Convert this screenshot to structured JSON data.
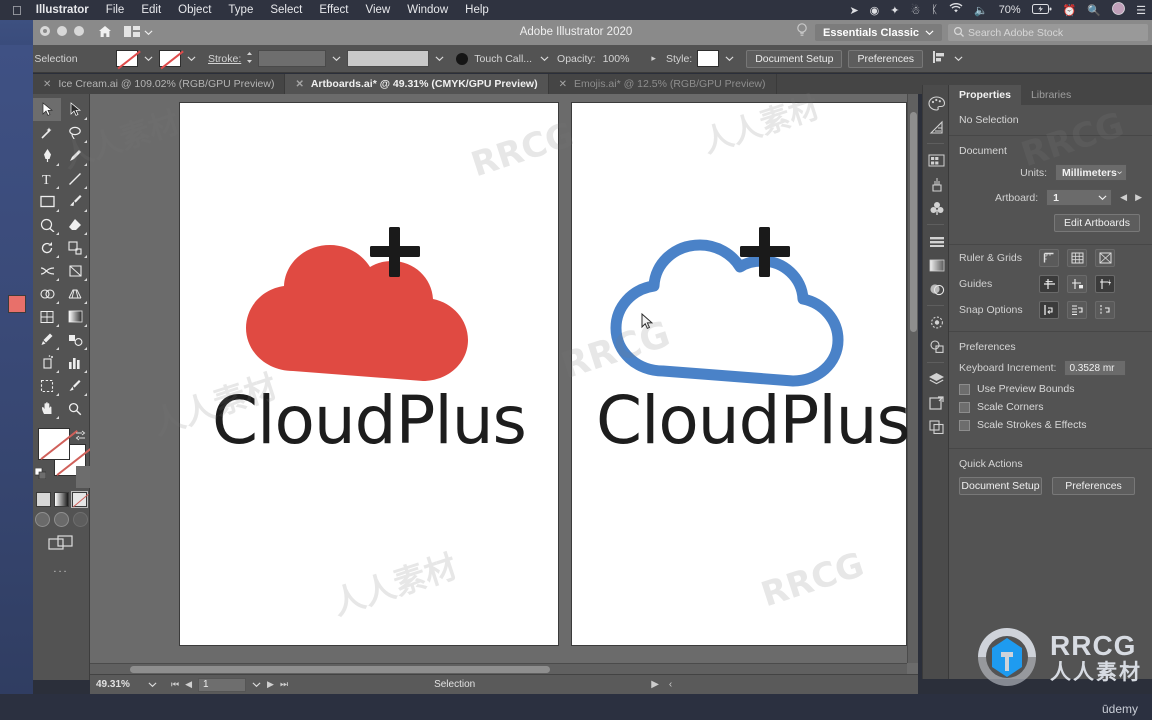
{
  "macbar": {
    "apple_icon": "apple-icon",
    "items": [
      {
        "label": "Illustrator",
        "bold": true
      },
      {
        "label": "File",
        "bold": false
      },
      {
        "label": "Edit",
        "bold": false
      },
      {
        "label": "Object",
        "bold": false
      },
      {
        "label": "Type",
        "bold": false
      },
      {
        "label": "Select",
        "bold": false
      },
      {
        "label": "Effect",
        "bold": false
      },
      {
        "label": "View",
        "bold": false
      },
      {
        "label": "Window",
        "bold": false
      },
      {
        "label": "Help",
        "bold": false
      }
    ],
    "status": {
      "battery_percent": "70%",
      "icons": [
        "location-icon",
        "spiral-icon",
        "dropbox-icon",
        "evernote-icon",
        "bluetooth-icon",
        "wifi-icon",
        "volume-icon",
        "battery-icon",
        "time-machine-icon",
        "spotlight-search-icon",
        "user-avatar-icon",
        "control-center-icon"
      ]
    }
  },
  "titlebar": {
    "title": "Adobe Illustrator 2020",
    "home_icon": "home-icon",
    "arrange_icon": "arrange-documents-icon",
    "search_help_icon": "help-bulb-icon",
    "workspace": "Essentials Classic",
    "search_placeholder": "Search Adobe Stock"
  },
  "controlbar": {
    "selection_state": "No Selection",
    "fill_label": "fill-swatch",
    "stroke_label": "Stroke:",
    "stroke_weight": "",
    "opacity_label": "Opacity:",
    "opacity_value": "100%",
    "style_label": "Style:",
    "touch_type_label": "Touch Call...",
    "document_setup": "Document Setup",
    "preferences": "Preferences",
    "align_icon": "align-icon"
  },
  "tabs": [
    {
      "name": "Ice Cream.ai @ 109.02% (RGB/GPU Preview)",
      "active": false,
      "dim": false
    },
    {
      "name": "Artboards.ai* @ 49.31% (CMYK/GPU Preview)",
      "active": true,
      "dim": false
    },
    {
      "name": "Emojis.ai* @ 12.5% (RGB/GPU Preview)",
      "active": false,
      "dim": true
    }
  ],
  "toolbar": {
    "tools": [
      {
        "name": "selection-tool",
        "glyph": "▷",
        "selected": true
      },
      {
        "name": "direct-selection-tool",
        "glyph": "▶",
        "selected": false
      },
      {
        "name": "magic-wand-tool",
        "glyph": "✧",
        "selected": false
      },
      {
        "name": "lasso-tool",
        "glyph": "◌",
        "selected": false
      },
      {
        "name": "pen-tool",
        "glyph": "✒",
        "selected": false
      },
      {
        "name": "curvature-tool",
        "glyph": "✐",
        "selected": false
      },
      {
        "name": "type-tool",
        "glyph": "T",
        "selected": false
      },
      {
        "name": "line-segment-tool",
        "glyph": "／",
        "selected": false
      },
      {
        "name": "rectangle-tool",
        "glyph": "▭",
        "selected": false
      },
      {
        "name": "paintbrush-tool",
        "glyph": "🖌",
        "selected": false
      },
      {
        "name": "shaper-tool",
        "glyph": "◔",
        "selected": false
      },
      {
        "name": "eraser-tool",
        "glyph": "◆",
        "selected": false
      },
      {
        "name": "rotate-tool",
        "glyph": "↻",
        "selected": false
      },
      {
        "name": "scale-tool",
        "glyph": "⧉",
        "selected": false
      },
      {
        "name": "width-tool",
        "glyph": "≋",
        "selected": false
      },
      {
        "name": "free-transform-tool",
        "glyph": "▨",
        "selected": false
      },
      {
        "name": "shape-builder-tool",
        "glyph": "◍",
        "selected": false
      },
      {
        "name": "perspective-grid-tool",
        "glyph": "▦",
        "selected": false
      },
      {
        "name": "mesh-tool",
        "glyph": "▩",
        "selected": false
      },
      {
        "name": "gradient-tool",
        "glyph": "▥",
        "selected": false
      },
      {
        "name": "eyedropper-tool",
        "glyph": "⚲",
        "selected": false
      },
      {
        "name": "blend-tool",
        "glyph": "❧",
        "selected": false
      },
      {
        "name": "symbol-sprayer-tool",
        "glyph": "⛉",
        "selected": false
      },
      {
        "name": "column-graph-tool",
        "glyph": "▊",
        "selected": false
      },
      {
        "name": "artboard-tool",
        "glyph": "⬚",
        "selected": false
      },
      {
        "name": "slice-tool",
        "glyph": "✂",
        "selected": false
      },
      {
        "name": "hand-tool",
        "glyph": "✋",
        "selected": false
      },
      {
        "name": "zoom-tool",
        "glyph": "🔍",
        "selected": false
      }
    ],
    "fill_stroke": {
      "fill": "none-fill-swatch",
      "stroke": "none-stroke-swatch"
    },
    "color_modes": [
      "color-swatch",
      "gradient-swatch",
      "none-swatch"
    ],
    "draw_modes": [
      "draw-normal",
      "draw-behind",
      "draw-inside"
    ],
    "screen_mode": "screen-mode-icon",
    "more_tools": "..."
  },
  "canvas": {
    "artboard_1": {
      "name": "artboard-red-logo",
      "logo_style": "filled",
      "cloud_color": "#E04A42",
      "plus_color": "#1A1A1A",
      "wordmark": "CloudPlus",
      "wordmark_color": "#1D1D1D"
    },
    "artboard_2": {
      "name": "artboard-blue-logo",
      "logo_style": "outlined",
      "cloud_color": "#4A82C8",
      "plus_color": "#1A1A1A",
      "wordmark": "CloudPlus",
      "wordmark_color": "#1D1D1D"
    },
    "cursor": "arrow-cursor"
  },
  "statusbar": {
    "zoom": "49.31%",
    "artboard_number": "1",
    "tool_status": "Selection"
  },
  "rightdock": {
    "icons": [
      "color-palette-icon",
      "color-guide-icon",
      "swatches-icon",
      "brushes-icon",
      "symbols-icon",
      "align-icon",
      "gradient-icon",
      "transparency-icon",
      "appearance-icon",
      "graphic-styles-icon",
      "layers-icon",
      "artboards-icon",
      "asset-export-icon"
    ]
  },
  "properties": {
    "tabs": [
      {
        "label": "Properties",
        "active": true
      },
      {
        "label": "Libraries",
        "active": false
      }
    ],
    "no_selection": "No Selection",
    "document_section": "Document",
    "units_label": "Units:",
    "units_value": "Millimeters",
    "artboard_label": "Artboard:",
    "artboard_value": "1",
    "edit_artboards": "Edit Artboards",
    "ruler_grids_label": "Ruler & Grids",
    "ruler_grids_icons": [
      "show-rulers-icon",
      "show-grid-icon",
      "show-transparency-grid-icon"
    ],
    "guides_label": "Guides",
    "guides_icons": [
      "show-guides-icon",
      "lock-guides-icon",
      "smart-guides-icon"
    ],
    "snap_options_label": "Snap Options",
    "snap_icons": [
      "snap-to-point-icon",
      "snap-to-grid-icon",
      "snap-to-pixel-icon"
    ],
    "preferences_section": "Preferences",
    "keyboard_increment_label": "Keyboard Increment:",
    "keyboard_increment_value": "0.3528 mr",
    "checkboxes": [
      {
        "label": "Use Preview Bounds",
        "checked": false
      },
      {
        "label": "Scale Corners",
        "checked": false
      },
      {
        "label": "Scale Strokes & Effects",
        "checked": false
      }
    ],
    "quick_actions_label": "Quick Actions",
    "quick_actions": [
      "Document Setup",
      "Preferences"
    ]
  },
  "watermarks": {
    "brand_text": "RRCG",
    "brand_sub": "人人素材",
    "platform": "ūdemy",
    "tiles": [
      "人人素材",
      "RRCG",
      "人人素材",
      "RRCG",
      "人人素材",
      "RRCG"
    ]
  }
}
